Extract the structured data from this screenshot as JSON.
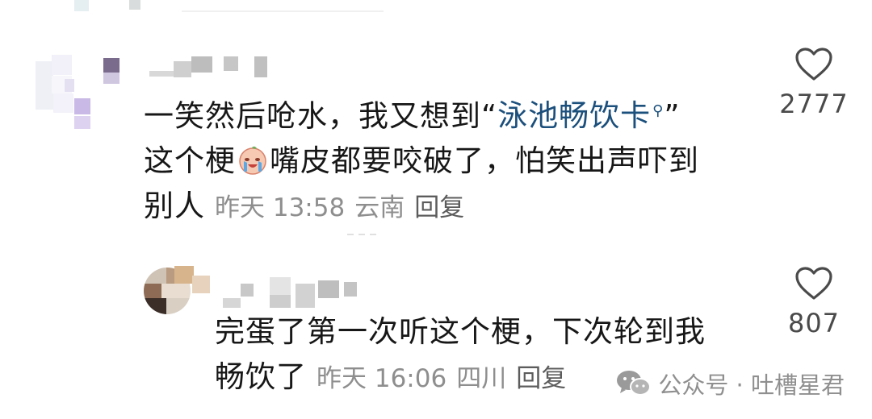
{
  "comments": [
    {
      "text_line1_a": "一笑然后呛水，我又想到“",
      "link": "泳池畅饮卡",
      "text_line1_b": "”",
      "text_line2_a": "这个梗",
      "text_line2_b": "嘴皮都要咬破了，怕笑出声吓到",
      "text_line3": "别人",
      "time": "昨天 13:58",
      "location": "云南",
      "reply": "回复",
      "likes": "2777"
    },
    {
      "text_line1": "完蛋了第一次听这个梗，下次轮到我",
      "text_line2": "畅饮了",
      "time": "昨天 16:06",
      "location": "四川",
      "reply": "回复",
      "likes": "807"
    }
  ],
  "icons": {
    "like": "heart-outline-icon",
    "link_search": "search-icon",
    "emoji": "crying-laughing-emoji-icon",
    "watermark": "wechat-icon"
  },
  "watermark": {
    "text": "公众号 · 吐槽星君"
  },
  "colors": {
    "link": "#1b4f7c",
    "meta": "#8e8e8e"
  }
}
